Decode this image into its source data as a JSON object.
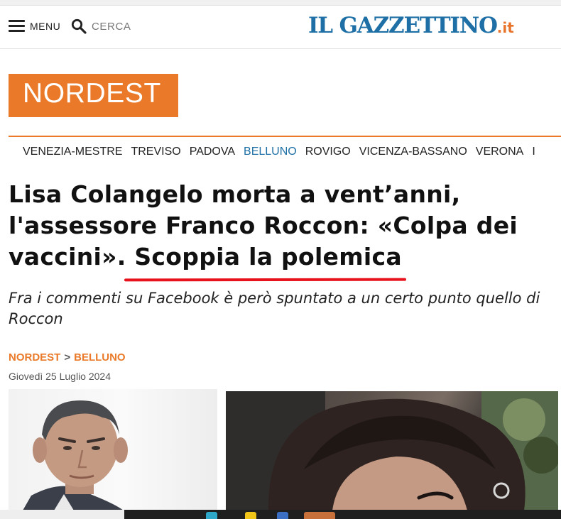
{
  "header": {
    "menu_label": "MENU",
    "search_label": "CERCA",
    "logo_main": "IL GAZZETTINO",
    "logo_tld": ".it"
  },
  "section": {
    "title": "NORDEST"
  },
  "subnav": {
    "items": [
      "VENEZIA-MESTRE",
      "TREVISO",
      "PADOVA",
      "BELLUNO",
      "ROVIGO",
      "VICENZA-BASSANO",
      "VERONA",
      "I"
    ],
    "active": "BELLUNO"
  },
  "article": {
    "headline_line1": "Lisa Colangelo morta a vent’anni,",
    "headline_line2": "l'assessore Franco Roccon: «Colpa dei",
    "headline_line3_a": "vaccini».",
    "headline_line3_b": " Scoppia la polemica",
    "subtitle": "Fra i commenti su Facebook è però spuntato a un certo punto quello di Roccon",
    "breadcrumb": {
      "section": "NORDEST",
      "separator": ">",
      "subsection": "BELLUNO"
    },
    "date": "Giovedì 25 Luglio 2024"
  },
  "colors": {
    "brand_blue": "#1d6fa5",
    "brand_orange": "#ea7a29",
    "highlight_red": "#e8121c"
  },
  "icons": [
    "hamburger-icon",
    "search-icon"
  ]
}
